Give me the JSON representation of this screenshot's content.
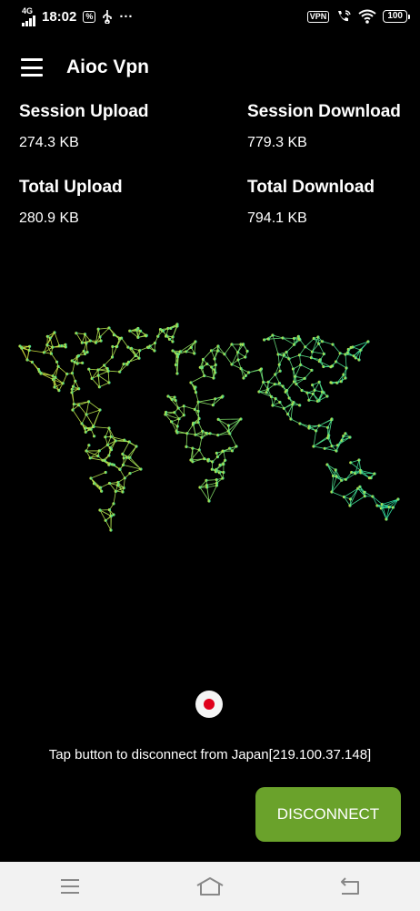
{
  "status_bar": {
    "time": "18:02",
    "network": "4G",
    "vpn_badge": "VPN",
    "battery": "100",
    "more": "···",
    "icons": [
      "signal-icon",
      "hd-icon",
      "usb-icon",
      "vpn-icon",
      "wifi-call-icon",
      "wifi-icon",
      "battery-icon"
    ]
  },
  "app_bar": {
    "title": "Aioc Vpn",
    "menu_icon": "hamburger-menu-icon"
  },
  "stats": {
    "session_upload": {
      "label": "Session Upload",
      "value": "274.3 KB"
    },
    "session_download": {
      "label": "Session Download",
      "value": "779.3 KB"
    },
    "total_upload": {
      "label": "Total Upload",
      "value": "280.9 KB"
    },
    "total_download": {
      "label": "Total Download",
      "value": "794.1 KB"
    }
  },
  "map": {
    "icon": "world-network-map",
    "color_start": "#d8e63c",
    "color_end": "#2ad8a0"
  },
  "connection": {
    "flag_icon": "japan-flag-icon",
    "message": "Tap button to disconnect from Japan[219.100.37.148]",
    "button_label": "DISCONNECT",
    "button_color": "#6aa22b"
  },
  "nav_bar": {
    "icons": [
      "recent-apps-icon",
      "home-icon",
      "back-icon"
    ]
  }
}
